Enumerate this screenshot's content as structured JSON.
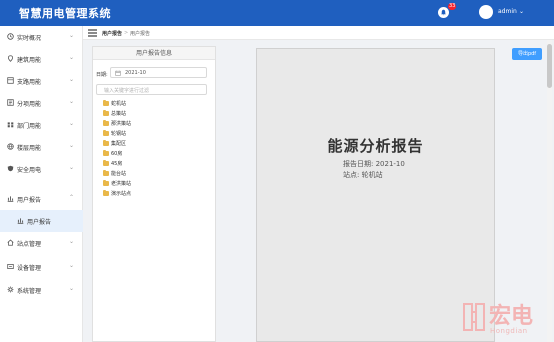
{
  "app": {
    "title": "智慧用电管理系统"
  },
  "header": {
    "notification_count": "33",
    "user_name": "admin"
  },
  "sidebar": {
    "items": [
      {
        "label": "实时概况",
        "icon": "clock-icon"
      },
      {
        "label": "建筑用能",
        "icon": "location-pin-icon"
      },
      {
        "label": "支路用能",
        "icon": "branch-box-icon"
      },
      {
        "label": "分项用能",
        "icon": "category-box-icon"
      },
      {
        "label": "部门用能",
        "icon": "department-icon"
      },
      {
        "label": "楼层用能",
        "icon": "globe-icon"
      },
      {
        "label": "安全用电",
        "icon": "shield-icon"
      },
      {
        "label": "用户报告",
        "icon": "report-icon"
      },
      {
        "label": "站点管理",
        "icon": "home-icon"
      },
      {
        "label": "设备管理",
        "icon": "device-icon"
      },
      {
        "label": "系统管理",
        "icon": "gear-icon"
      }
    ],
    "sub_item": {
      "label": "用户报告",
      "icon": "report-icon"
    }
  },
  "breadcrumb": {
    "items": [
      "用户报告",
      "用户报告"
    ],
    "separator": ">"
  },
  "tree_panel": {
    "title": "用户报告信息",
    "date_label": "日期:",
    "date_value": "2021-10",
    "search_placeholder": "输入关键字进行过滤",
    "nodes": [
      "蛇机站",
      "总策站",
      "那洪策站",
      "轮钢站",
      "集配区",
      "60房",
      "45房",
      "能台站",
      "老洪策站",
      "演示站点"
    ]
  },
  "report": {
    "title": "能源分析报告",
    "date_line": "报告日期:  2021-10",
    "site_line": "站点:  轮机站"
  },
  "toolbar": {
    "export_label": "导出pdf"
  },
  "watermark": {
    "brand": "宏电",
    "sub": "Hongdian"
  },
  "colors": {
    "header_bg": "#1f5fbf",
    "accent": "#409eff",
    "selected_bg": "#e6f0fc",
    "folder": "#e9b84a"
  }
}
